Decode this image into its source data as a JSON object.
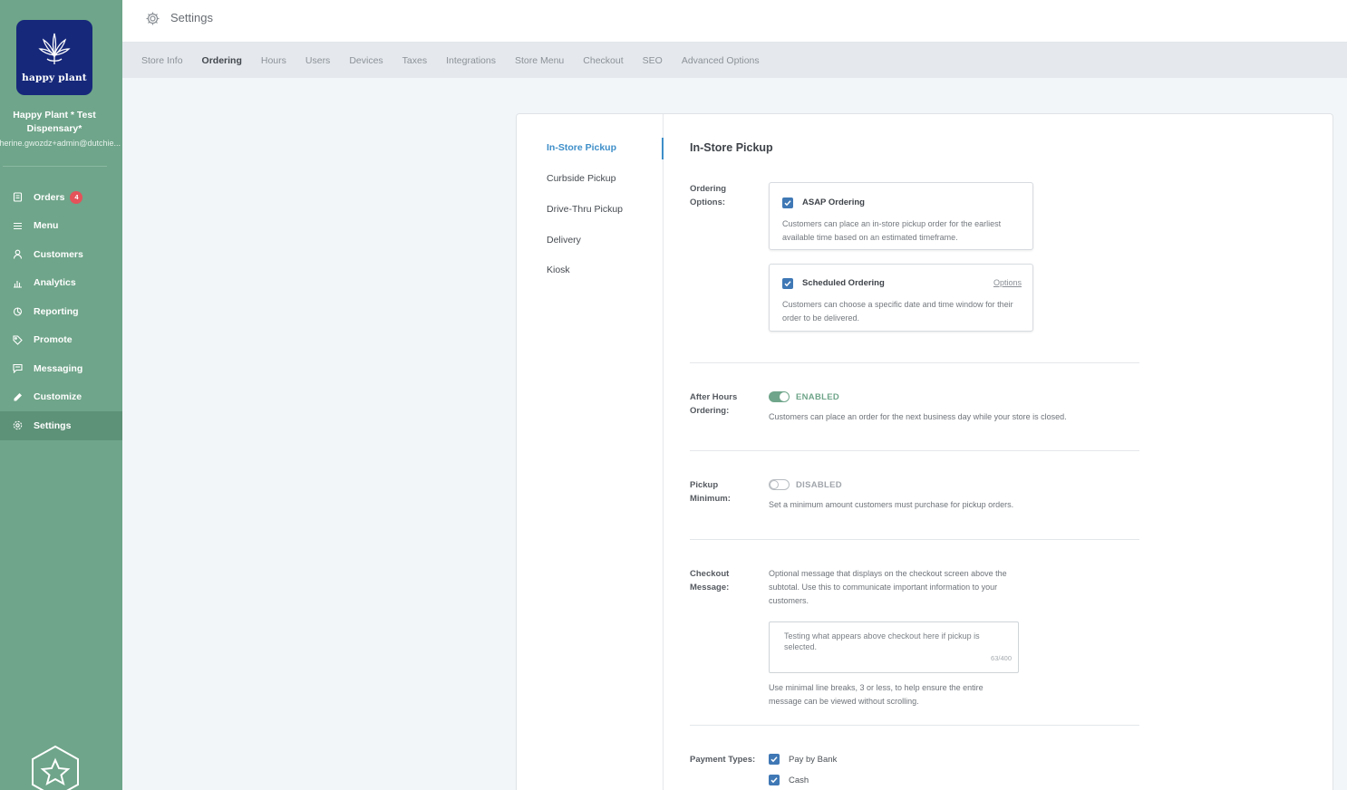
{
  "sidebar": {
    "logo_text": "happy plant",
    "store_name": "Happy Plant * Test Dispensary*",
    "store_email": "atherine.gwozdz+admin@dutchie...",
    "nav": [
      {
        "label": "Orders",
        "icon": "orders-icon",
        "badge": "4"
      },
      {
        "label": "Menu",
        "icon": "menu-icon"
      },
      {
        "label": "Customers",
        "icon": "customers-icon"
      },
      {
        "label": "Analytics",
        "icon": "analytics-icon"
      },
      {
        "label": "Reporting",
        "icon": "reporting-icon"
      },
      {
        "label": "Promote",
        "icon": "tag-icon"
      },
      {
        "label": "Messaging",
        "icon": "messaging-icon"
      },
      {
        "label": "Customize",
        "icon": "pencil-icon"
      },
      {
        "label": "Settings",
        "icon": "gear-icon",
        "active": true
      }
    ]
  },
  "header": {
    "title": "Settings"
  },
  "tabs": [
    "Store Info",
    "Ordering",
    "Hours",
    "Users",
    "Devices",
    "Taxes",
    "Integrations",
    "Store Menu",
    "Checkout",
    "SEO",
    "Advanced Options"
  ],
  "active_tab": "Ordering",
  "subnav": [
    "In-Store Pickup",
    "Curbside Pickup",
    "Drive-Thru Pickup",
    "Delivery",
    "Kiosk"
  ],
  "active_subnav": "In-Store Pickup",
  "section": {
    "title": "In-Store Pickup",
    "ordering_options": {
      "label_line1": "Ordering",
      "label_line2": "Options:",
      "asap": {
        "title": "ASAP Ordering",
        "checked": true,
        "desc": "Customers can place an in-store pickup order for the earliest available time based on an estimated timeframe."
      },
      "scheduled": {
        "title": "Scheduled Ordering",
        "checked": true,
        "link": "Options",
        "desc": "Customers can choose a specific date and time window for their order to be delivered."
      }
    },
    "after_hours": {
      "label_line1": "After Hours",
      "label_line2": "Ordering:",
      "state": "ENABLED",
      "desc": "Customers can place an order for the next business day while your store is closed."
    },
    "pickup_minimum": {
      "label_line1": "Pickup",
      "label_line2": "Minimum:",
      "state": "DISABLED",
      "desc": "Set a minimum amount customers must purchase for pickup orders."
    },
    "checkout_message": {
      "label_line1": "Checkout",
      "label_line2": "Message:",
      "desc": "Optional message that displays on the checkout screen above the subtotal. Use this to communicate important information to your customers.",
      "value": "Testing what appears above checkout here if pickup is selected.",
      "counter": "63/400",
      "hint": "Use minimal line breaks, 3 or less, to help ensure the entire message can be viewed without scrolling."
    },
    "payment_types": {
      "label": "Payment Types:",
      "items": [
        "Pay by Bank",
        "Cash"
      ]
    }
  },
  "colors": {
    "sidebar": "#6fa58a",
    "accent_blue": "#3d8ec9",
    "checkbox": "#3f78b5",
    "badge": "#e4525a",
    "logo_bg": "#16287a"
  }
}
